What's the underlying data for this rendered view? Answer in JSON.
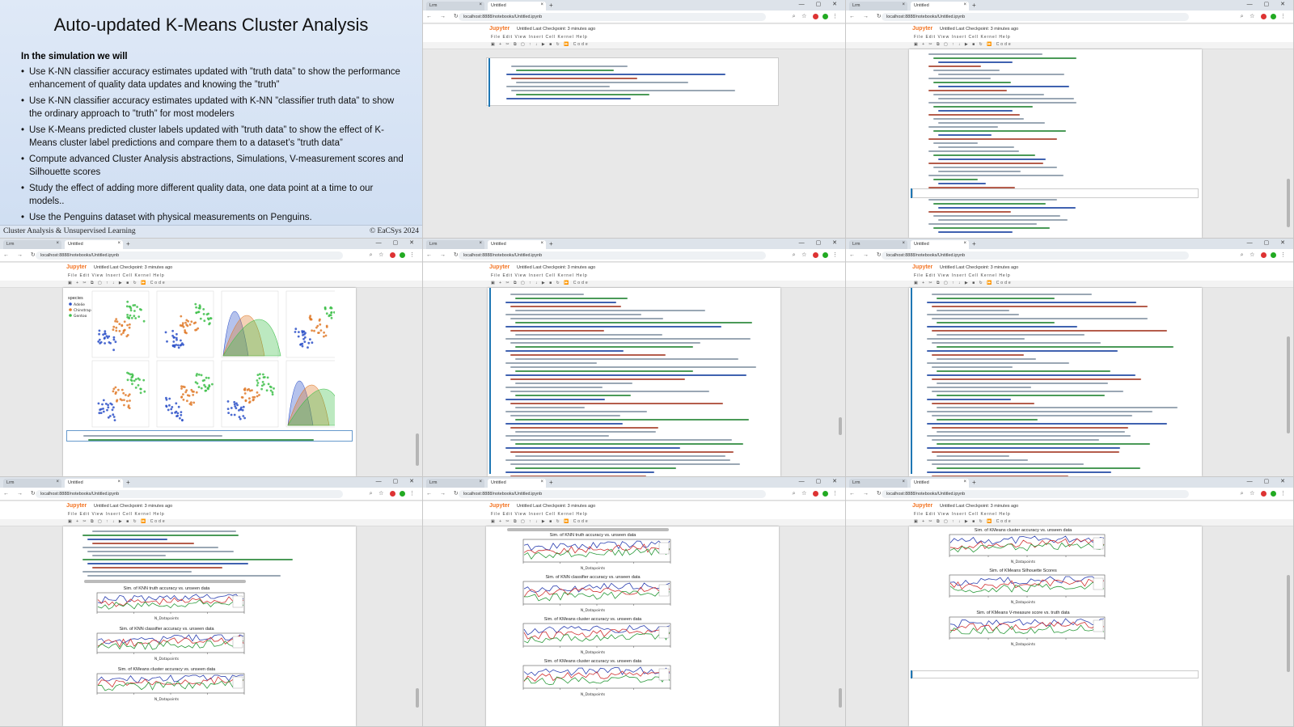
{
  "slide": {
    "title": "Auto-updated K-Means Cluster Analysis",
    "subtitle": "In the simulation we will",
    "bullets": [
      "Use K-NN classifier accuracy estimates updated with ”truth data” to show the performance enhancement of quality data updates and knowing the ”truth”",
      "Use K-NN classifier accuracy estimates updated with K-NN ”classifier truth data” to show the ordinary approach to ”truth” for most modelers",
      "Use K-Means predicted cluster labels updated with ”truth data” to show the effect of K-Means cluster label predictions and compare them to a dataset’s ”truth data”",
      "Compute advanced Cluster Analysis abstractions, Simulations, V-measurement scores and Silhouette scores",
      "Study the effect of adding more different quality data, one data point at a time to our models..",
      "Use the Penguins dataset with physical measurements on Penguins."
    ],
    "footer_left": "Cluster Analysis & Unsupervised Learning",
    "footer_right": "© EaCSys 2024"
  },
  "browser": {
    "tab1": "Lrm",
    "tab2": "Untitled",
    "url": "localhost:8888/notebooks/Untitled.ipynb",
    "jupyter_logo": "Jupyter",
    "notebook_name": "Untitled  Last Checkpoint: 3 minutes ago",
    "menu": "File  Edit  View  Insert  Cell  Kernel  Help",
    "toolbar": "▣ + ✂ ⧉ ▢ ↑ ↓ ▶ ■ ↻ ⏩ Code"
  },
  "plots": {
    "p1": "Sim. of KNN truth accuracy vs. unseen data",
    "p2": "Sim. of KNN classifier accuracy vs. unseen data",
    "p3": "Sim. of KMeans cluster accuracy vs. unseen data",
    "p4": "Sim. of KMeans Silhouette Scores",
    "p5": "Sim. of KMeans V-measure score vs. truth data",
    "xlabel": "N_Datapoints",
    "pair_legend_title": "species",
    "pair_legend": [
      "Adelie",
      "Chinstrap",
      "Gentoo"
    ]
  },
  "colors": {
    "adelie": "#2b50c8",
    "chinstrap": "#e07b2c",
    "gentoo": "#3ec04a",
    "line_blue": "#2b3fb0",
    "line_red": "#d03030",
    "line_green": "#2a9a3a",
    "line_purple": "#5a2a8a"
  }
}
